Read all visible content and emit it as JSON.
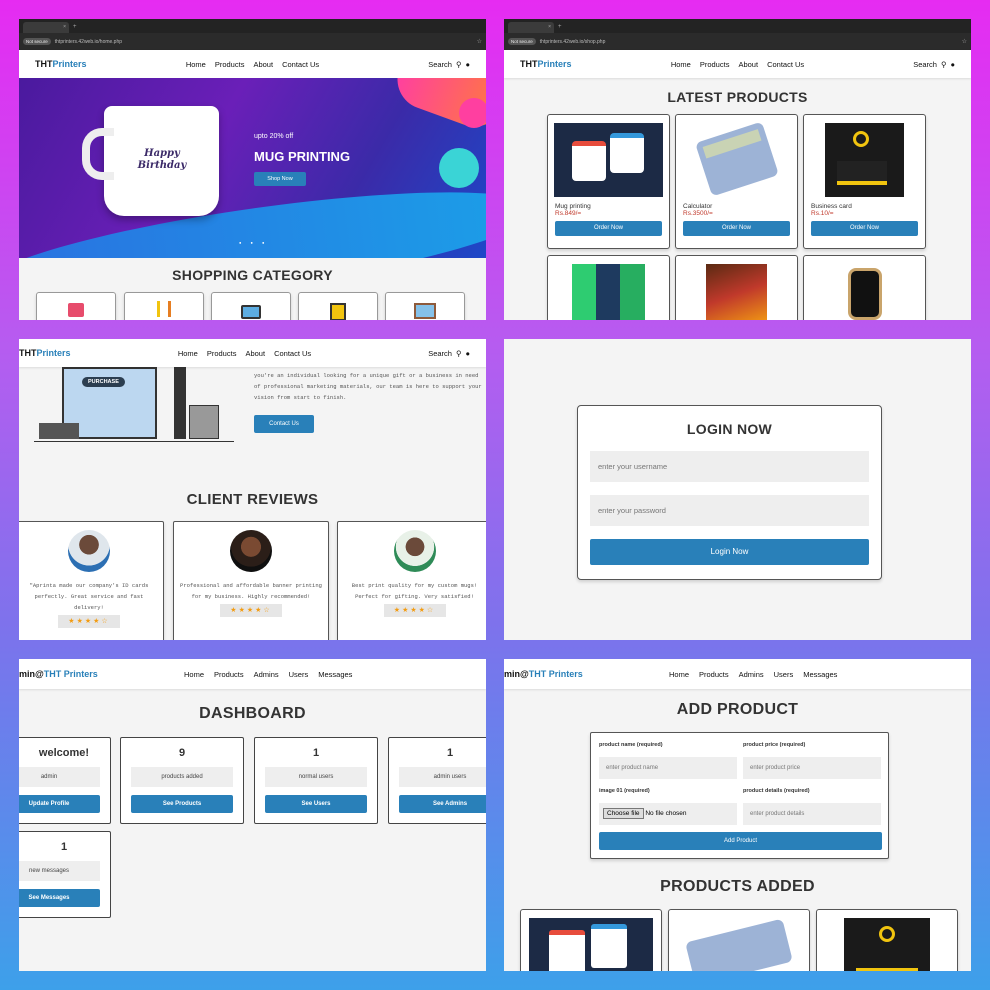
{
  "browser": {
    "url_home": "thtprinters.42web.io/home.php",
    "url_shop": "thtprinters.42web.io/shop.php",
    "not_secure": "Not secure"
  },
  "nav": {
    "logo_a": "THT",
    "logo_b": "Printers",
    "home": "Home",
    "products": "Products",
    "about": "About",
    "contact": "Contact Us",
    "search": "Search"
  },
  "hero": {
    "tag": "upto 20% off",
    "title": "MUG PRINTING",
    "cta": "Shop Now",
    "mug_text": "Happy Birthday"
  },
  "shopping": {
    "title": "SHOPPING CATEGORY"
  },
  "latest": {
    "title": "LATEST PRODUCTS",
    "items": [
      {
        "name": "Mug printing",
        "price": "Rs.849/=",
        "btn": "Order Now"
      },
      {
        "name": "Calculator",
        "price": "Rs.3500/=",
        "btn": "Order Now"
      },
      {
        "name": "Business card",
        "price": "Rs.10/=",
        "btn": "Order Now"
      }
    ]
  },
  "about": {
    "text": "you're an individual looking for a unique gift or a business in need of professional marketing materials, our team is here to support your vision from start to finish.",
    "cta": "Contact Us",
    "purchase": "PURCHASE"
  },
  "reviews": {
    "title": "CLIENT REVIEWS",
    "items": [
      {
        "text": "\"Aprinta made our company's ID cards perfectly. Great service and fast delivery!",
        "stars": "★★★★☆"
      },
      {
        "text": "Professional and affordable banner printing for my business. Highly recommended!",
        "stars": "★★★★☆"
      },
      {
        "text": "Best print quality for my custom mugs! Perfect for gifting. Very satisfied!",
        "stars": "★★★★☆"
      }
    ]
  },
  "login": {
    "title": "LOGIN NOW",
    "username_ph": "enter your username",
    "password_ph": "enter your password",
    "btn": "Login Now"
  },
  "admin_nav": {
    "logo_a": "min@",
    "logo_b": "THT Printers",
    "home": "Home",
    "products": "Products",
    "admins": "Admins",
    "users": "Users",
    "messages": "Messages"
  },
  "dashboard": {
    "title": "DASHBOARD",
    "cards": [
      {
        "num": "welcome!",
        "label": "admin",
        "btn": "Update Profile"
      },
      {
        "num": "9",
        "label": "products added",
        "btn": "See Products"
      },
      {
        "num": "1",
        "label": "normal users",
        "btn": "See Users"
      },
      {
        "num": "1",
        "label": "admin users",
        "btn": "See Admins"
      },
      {
        "num": "1",
        "label": "new messages",
        "btn": "See Messages"
      }
    ]
  },
  "add_product": {
    "title": "ADD PRODUCT",
    "name_lbl": "product name (required)",
    "name_ph": "enter product name",
    "price_lbl": "product price (required)",
    "price_ph": "enter product price",
    "image_lbl": "image 01 (required)",
    "choose": "Choose file",
    "no_file": "No file chosen",
    "details_lbl": "product details (required)",
    "details_ph": "enter product details",
    "btn": "Add Product",
    "added_title": "PRODUCTS ADDED"
  },
  "colors": {
    "accent": "#2980b9",
    "price": "#c0392b",
    "star": "#f39c12"
  }
}
